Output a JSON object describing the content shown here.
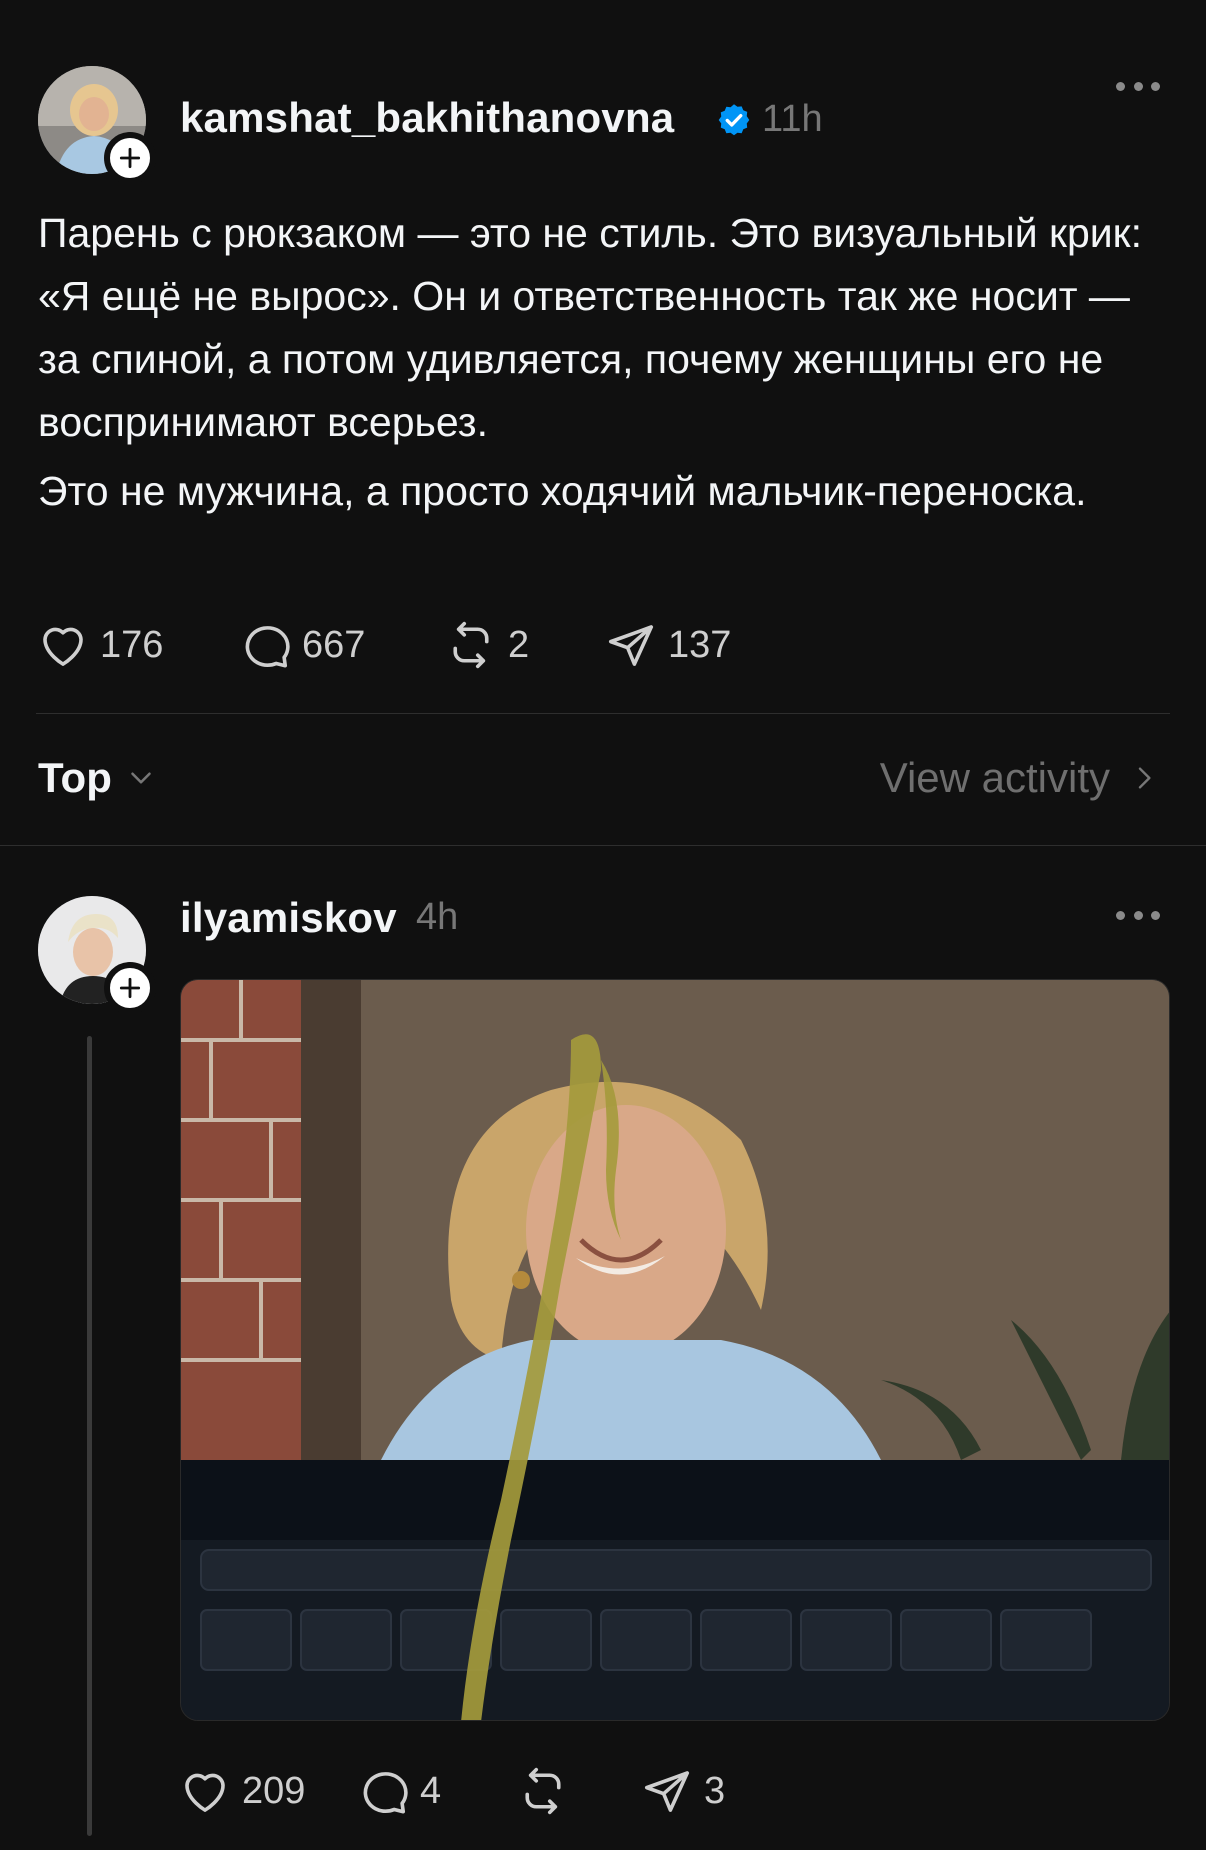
{
  "post": {
    "username": "kamshat_bakhithanovna",
    "time": "11h",
    "verified": true,
    "paragraphs": [
      "Парень с рюкзаком — это не стиль. Это визуальный крик: «Я ещё не вырос». Он и ответственность так же носит — за спиной, а потом удивляется, почему женщины его не воспринимают всерьез.",
      "Это не мужчина, а просто ходячий мальчик-переноска."
    ],
    "stats": {
      "likes": "176",
      "comments": "667",
      "reposts": "2",
      "shares": "137"
    }
  },
  "replies_header": {
    "sort_label": "Top",
    "view_activity": "View activity"
  },
  "reply": {
    "username": "ilyamiskov",
    "time": "4h",
    "stats": {
      "likes": "209",
      "comments": "4",
      "reposts": "",
      "shares": "3"
    }
  },
  "colors": {
    "background": "#101010",
    "text": "#f3f5f7",
    "muted": "#777777",
    "verified": "#0095f6"
  },
  "icons": [
    "plus-icon",
    "verified-icon",
    "more-icon",
    "heart-icon",
    "comment-icon",
    "repost-icon",
    "share-icon",
    "chevron-down-icon",
    "chevron-right-icon"
  ]
}
